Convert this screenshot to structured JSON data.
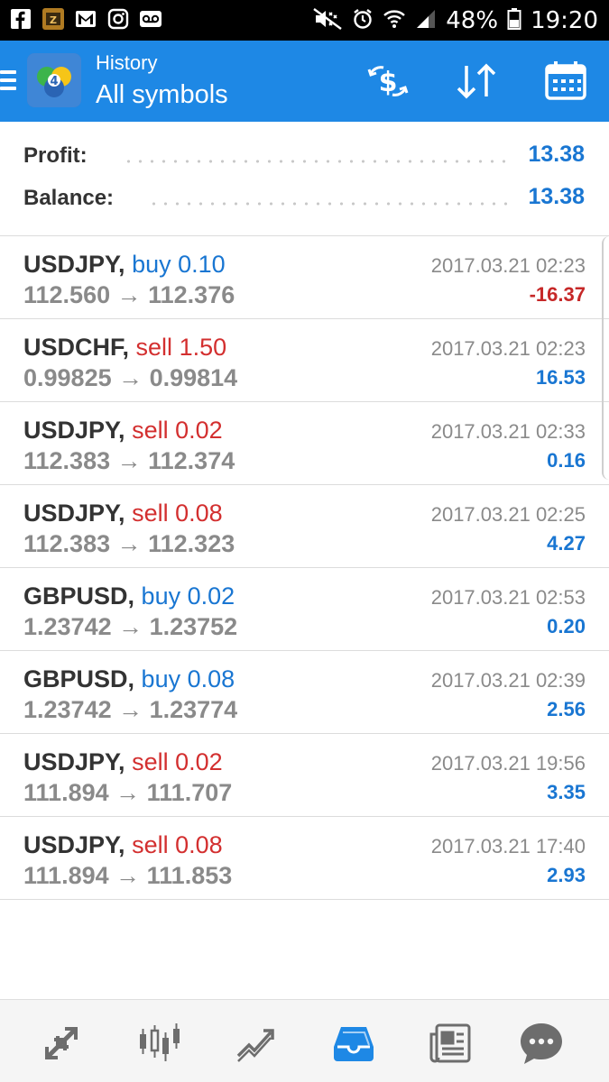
{
  "status_bar": {
    "battery": "48%",
    "time": "19:20"
  },
  "app_bar": {
    "title": "History",
    "subtitle": "All symbols",
    "icons": [
      "menu-icon",
      "metatrader-logo",
      "deposit-withdraw-icon",
      "sort-icon",
      "calendar-icon"
    ]
  },
  "summary": {
    "profit_label": "Profit:",
    "profit_value": "13.38",
    "balance_label": "Balance:",
    "balance_value": "13.38"
  },
  "deals": [
    {
      "symbol": "USDJPY,",
      "side": "buy",
      "volume": "0.10",
      "prices": "112.560 → 112.376",
      "time": "2017.03.21 02:23",
      "pl": "-16.37"
    },
    {
      "symbol": "USDCHF,",
      "side": "sell",
      "volume": "1.50",
      "prices": "0.99825 → 0.99814",
      "time": "2017.03.21 02:23",
      "pl": "16.53"
    },
    {
      "symbol": "USDJPY,",
      "side": "sell",
      "volume": "0.02",
      "prices": "112.383 → 112.374",
      "time": "2017.03.21 02:33",
      "pl": "0.16"
    },
    {
      "symbol": "USDJPY,",
      "side": "sell",
      "volume": "0.08",
      "prices": "112.383 → 112.323",
      "time": "2017.03.21 02:25",
      "pl": "4.27"
    },
    {
      "symbol": "GBPUSD,",
      "side": "buy",
      "volume": "0.02",
      "prices": "1.23742 → 1.23752",
      "time": "2017.03.21 02:53",
      "pl": "0.20"
    },
    {
      "symbol": "GBPUSD,",
      "side": "buy",
      "volume": "0.08",
      "prices": "1.23742 → 1.23774",
      "time": "2017.03.21 02:39",
      "pl": "2.56"
    },
    {
      "symbol": "USDJPY,",
      "side": "sell",
      "volume": "0.02",
      "prices": "111.894 → 111.707",
      "time": "2017.03.21 19:56",
      "pl": "3.35"
    },
    {
      "symbol": "USDJPY,",
      "side": "sell",
      "volume": "0.08",
      "prices": "111.894 → 111.853",
      "time": "2017.03.21 17:40",
      "pl": "2.93"
    }
  ],
  "bottom_nav": {
    "items": [
      "quotes-icon",
      "chart-icon",
      "trade-icon",
      "history-icon",
      "news-icon",
      "chat-icon"
    ],
    "active": "history-icon"
  },
  "colors": {
    "accent": "#1e88e5",
    "buy": "#1976d2",
    "sell": "#d32f2f",
    "loss": "#c62828",
    "text_gray": "#8a8a8a"
  }
}
